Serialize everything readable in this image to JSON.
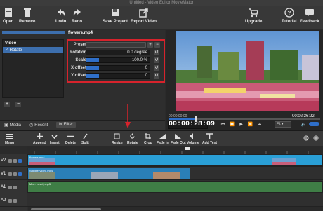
{
  "window": {
    "title": "Untitled - Video Editor MovieMator"
  },
  "toolbar": {
    "open": "Open",
    "remove": "Remove",
    "undo": "Undo",
    "redo": "Redo",
    "save_project": "Save Project",
    "export_video": "Export Video",
    "upgrade": "Upgrade",
    "tutorial": "Tutorial",
    "feedback": "Feedback"
  },
  "filters_panel": {
    "clip_name": "flowers.mp4",
    "list_header": "Video",
    "list_items": [
      "Rotate"
    ],
    "preset_label": "Preset",
    "params": [
      {
        "label": "Rotation",
        "value": "0.0 degree",
        "fill": 0.0
      },
      {
        "label": "Scale",
        "value": "100.0 %",
        "fill": 0.2
      },
      {
        "label": "X offset",
        "value": "0",
        "fill": 0.2
      },
      {
        "label": "Y offset",
        "value": "0",
        "fill": 0.2
      }
    ]
  },
  "tabs": {
    "media": "Media",
    "recent": "Recent",
    "filter": "Filter"
  },
  "player": {
    "start_time": "00:00:00:00",
    "duration": "00:02:36:22",
    "timecode": "00:00:28:09",
    "zoom": "Fit"
  },
  "timeline_toolbar": {
    "menu": "Menu",
    "append": "Append",
    "insert": "Insert",
    "delete": "Delete",
    "split": "Split",
    "resize": "Resize",
    "rotate": "Rotate",
    "crop": "Crop",
    "fade_in": "Fade In",
    "fade_out": "Fade Out",
    "volume": "Volume",
    "add_text": "Add Text"
  },
  "tracks": {
    "heads": [
      "V2",
      "V1",
      "A1",
      "A2"
    ],
    "clip_v2_title": "flowers.mp4",
    "clip_v1_title": "Wildlife Video.mp4",
    "clip_a1_title": "Mix - Lovely.mp3"
  },
  "colors": {
    "accent": "#2f6fc9",
    "highlight_red": "#d7232c",
    "track_clip": "#2a9fd6",
    "audio_clip": "#3f7e46"
  }
}
